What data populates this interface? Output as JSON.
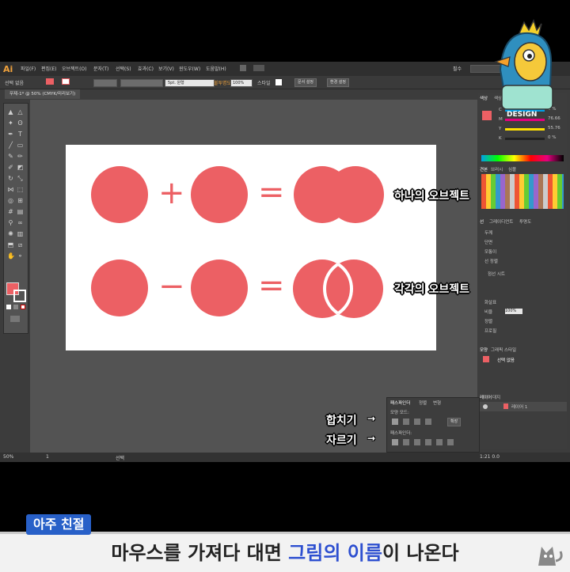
{
  "app": {
    "logo": "Ai",
    "menu": [
      "파일(F)",
      "편집(E)",
      "오브젝트(O)",
      "문자(T)",
      "선택(S)",
      "효과(C)",
      "보기(V)",
      "윈도우(W)",
      "도움말(H)"
    ],
    "workspace": "필수",
    "control_bar": {
      "selection_label": "선택 없음",
      "stroke_size": "5pt. 원형",
      "opacity_label": "불투명도",
      "opacity_value": "100%",
      "style_label": "스타일",
      "doc_setup": "문서 설정",
      "prefs": "환경 설정"
    },
    "document_tab": "무제-1* @ 50% (CMYK/미리보기)",
    "status": {
      "zoom": "50%",
      "page": "1",
      "mode": "선택",
      "coords": "1:21 0.0"
    },
    "panels": {
      "color_tab": "색상",
      "color_guide_tab": "색상 안내",
      "cmyk": [
        {
          "ch": "C",
          "value": "0 %",
          "color": "#00a0e9"
        },
        {
          "ch": "M",
          "value": "76.66",
          "color": "#e4007f"
        },
        {
          "ch": "Y",
          "value": "55.76",
          "color": "#ffe100"
        },
        {
          "ch": "K",
          "value": "0 %",
          "color": "#222222"
        }
      ],
      "swatches_tabs": [
        "견본",
        "브러시",
        "심볼"
      ],
      "stroke_tabs": [
        "선",
        "그레이디언트",
        "투명도"
      ],
      "stroke_labels": [
        "두께",
        "단면",
        "모퉁이",
        "선 정렬"
      ],
      "dashed_label": "점선 시트",
      "profile_labels": [
        "화살표",
        "비율",
        "정렬",
        "프로필"
      ],
      "profile_percent": "100%",
      "appearance_tabs": [
        "모양",
        "그래픽 스타일"
      ],
      "appearance_title": "선택 없음",
      "layers_tabs": [
        "레이어",
        "대지"
      ],
      "layer_name": "레이어 1",
      "pathfinder_tabs": [
        "패스파인더",
        "정렬",
        "변형"
      ],
      "shape_modes_label": "모양 모드:",
      "pathfinders_label": "패스파인더:",
      "expand_button": "확장"
    }
  },
  "artwork": {
    "fill_color": "#ec6064",
    "row1_ops": [
      "+",
      "="
    ],
    "row2_ops": [
      "−",
      "="
    ]
  },
  "annotations": {
    "merged": "하나의 오브젝트",
    "separate": "각각의 오브젝트",
    "unite": "합치기",
    "divide": "자르기",
    "arrow": "→"
  },
  "mascot": {
    "label": "DESIGN"
  },
  "caption": {
    "tag": "아주 친절",
    "part1": "마우스를 가져다 대면 ",
    "highlight": "그림의 이름",
    "part2": "이 나온다"
  }
}
